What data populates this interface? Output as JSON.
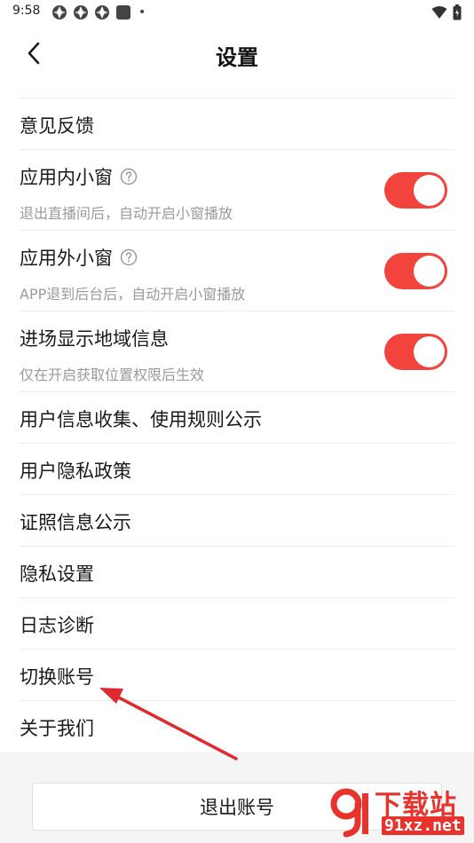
{
  "status_bar": {
    "time": "9:58",
    "dot": "•"
  },
  "header": {
    "title": "设置"
  },
  "settings": {
    "feedback": "意见反馈",
    "in_app_window": {
      "label": "应用内小窗",
      "description": "退出直播间后，自动开启小窗播放",
      "enabled": true
    },
    "out_app_window": {
      "label": "应用外小窗",
      "description": "APP退到后台后，自动开启小窗播放",
      "enabled": true
    },
    "region_display": {
      "label": "进场显示地域信息",
      "description": "仅在开启获取位置权限后生效",
      "enabled": true
    },
    "info_collection": "用户信息收集、使用规则公示",
    "privacy_policy": "用户隐私政策",
    "license_info": "证照信息公示",
    "privacy_settings": "隐私设置",
    "log_diagnosis": "日志诊断",
    "switch_account": "切换账号",
    "about_us": "关于我们"
  },
  "footer": {
    "logout_label": "退出账号"
  },
  "watermark": {
    "title": "下载站",
    "url": "91xz.net"
  },
  "colors": {
    "accent": "#f2433c",
    "annotation": "#e0282e",
    "watermark": "#e8332d"
  }
}
